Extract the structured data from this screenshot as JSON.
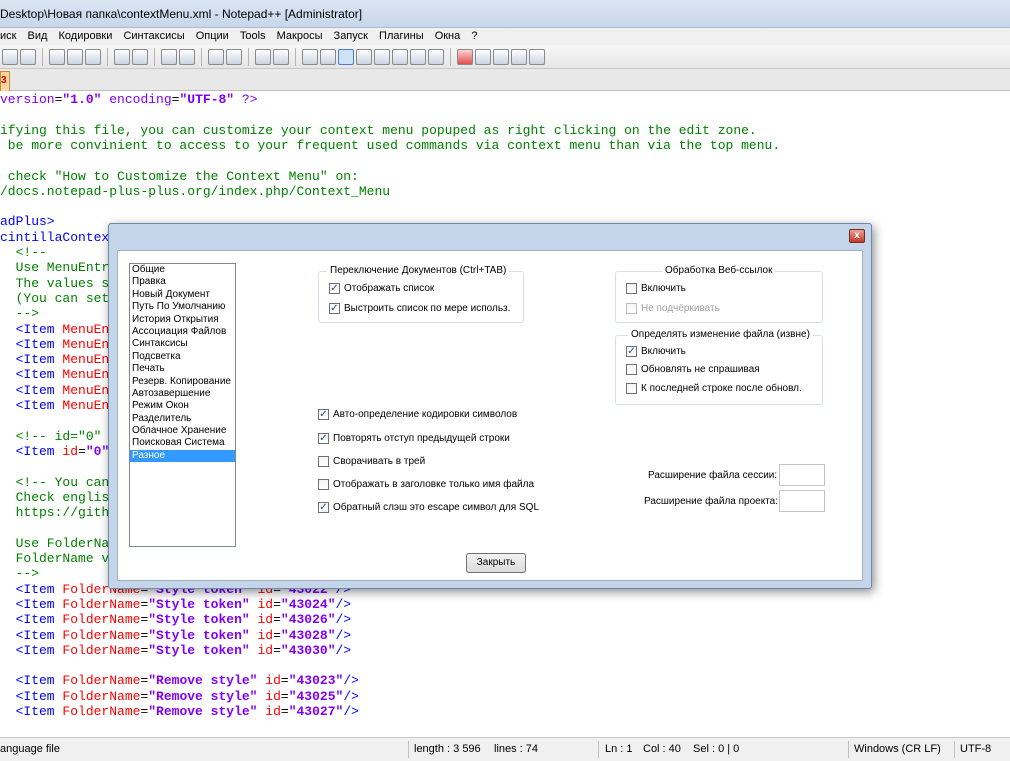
{
  "window": {
    "title": "Desktop\\Новая папка\\contextMenu.xml - Notepad++ [Administrator]"
  },
  "menu": [
    "иск",
    "Вид",
    "Кодировки",
    "Синтаксисы",
    "Опции",
    "Tools",
    "Макросы",
    "Запуск",
    "Плагины",
    "Окна",
    "?"
  ],
  "tab": {
    "label": "3"
  },
  "editor": {
    "lines": [
      {
        "y": 0,
        "segs": [
          [
            "c-decl",
            "version"
          ],
          [
            "c-text",
            "="
          ],
          [
            "c-str",
            "\"1.0\""
          ],
          [
            "c-text",
            " "
          ],
          [
            "c-decl",
            "encoding"
          ],
          [
            "c-text",
            "="
          ],
          [
            "c-str",
            "\"UTF-8\""
          ],
          [
            "c-text",
            " "
          ],
          [
            "c-decl",
            "?>"
          ]
        ]
      },
      {
        "y": 1,
        "segs": []
      },
      {
        "y": 2,
        "segs": [
          [
            "c-comment",
            "ifying this file, you can customize your context menu popuped as right clicking on the edit zone."
          ]
        ]
      },
      {
        "y": 3,
        "segs": [
          [
            "c-comment",
            " be more convinient to access to your frequent used commands via context menu than via the top menu."
          ]
        ]
      },
      {
        "y": 4,
        "segs": []
      },
      {
        "y": 5,
        "segs": [
          [
            "c-comment",
            " check \"How to Customize the Context Menu\" on:"
          ]
        ]
      },
      {
        "y": 6,
        "segs": [
          [
            "c-comment",
            "/docs.notepad-plus-plus.org/index.php/Context_Menu"
          ]
        ]
      },
      {
        "y": 7,
        "segs": []
      },
      {
        "y": 8,
        "segs": [
          [
            "c-tag",
            "adPlus>"
          ]
        ]
      },
      {
        "y": 9,
        "segs": [
          [
            "c-tag",
            "cintillaContextMenu>"
          ]
        ]
      },
      {
        "y": 10,
        "segs": [
          [
            "c-comment",
            "  <!--"
          ]
        ]
      },
      {
        "y": 11,
        "segs": [
          [
            "c-comment",
            "  Use MenuEntryName and MenuItemName to localize your commands to add."
          ]
        ]
      },
      {
        "y": 12,
        "segs": [
          [
            "c-comment",
            "  The values should be in English but not in translated language."
          ]
        ]
      },
      {
        "y": 13,
        "segs": [
          [
            "c-comment",
            "  (You can set values in translated language)"
          ]
        ]
      },
      {
        "y": 14,
        "segs": [
          [
            "c-comment",
            "  -->"
          ]
        ]
      },
      {
        "y": 15,
        "segs": [
          [
            "c-tag",
            "  <Item "
          ],
          [
            "c-attr",
            "MenuEntryName"
          ]
        ]
      },
      {
        "y": 16,
        "segs": [
          [
            "c-tag",
            "  <Item "
          ],
          [
            "c-attr",
            "MenuEntryName"
          ]
        ]
      },
      {
        "y": 17,
        "segs": [
          [
            "c-tag",
            "  <Item "
          ],
          [
            "c-attr",
            "MenuEntryName"
          ]
        ]
      },
      {
        "y": 18,
        "segs": [
          [
            "c-tag",
            "  <Item "
          ],
          [
            "c-attr",
            "MenuEntryName"
          ]
        ]
      },
      {
        "y": 19,
        "segs": [
          [
            "c-tag",
            "  <Item "
          ],
          [
            "c-attr",
            "MenuEntryName"
          ]
        ]
      },
      {
        "y": 20,
        "segs": [
          [
            "c-tag",
            "  <Item "
          ],
          [
            "c-attr",
            "MenuEntryName"
          ]
        ]
      },
      {
        "y": 21,
        "segs": []
      },
      {
        "y": 22,
        "segs": [
          [
            "c-comment",
            "  <!-- id=\"0\" is the separator -->"
          ]
        ]
      },
      {
        "y": 23,
        "segs": [
          [
            "c-tag",
            "  <Item "
          ],
          [
            "c-attr",
            "id"
          ],
          [
            "c-text",
            "="
          ],
          [
            "c-str",
            "\"0\""
          ],
          [
            "c-tag",
            "/>"
          ]
        ]
      },
      {
        "y": 24,
        "segs": []
      },
      {
        "y": 25,
        "segs": [
          [
            "c-comment",
            "  <!-- You can find all Notepad++ command id in:"
          ]
        ]
      },
      {
        "y": 26,
        "segs": [
          [
            "c-comment",
            "  Check english.xml"
          ]
        ]
      },
      {
        "y": 27,
        "segs": [
          [
            "c-comment",
            "  https://github.com/notepad-plus-plus"
          ]
        ]
      },
      {
        "y": 28,
        "segs": []
      },
      {
        "y": 29,
        "segs": [
          [
            "c-comment",
            "  Use FolderName to group commands"
          ]
        ]
      },
      {
        "y": 30,
        "segs": [
          [
            "c-comment",
            "  FolderName value can be in any language"
          ]
        ]
      },
      {
        "y": 31,
        "segs": [
          [
            "c-comment",
            "  -->"
          ]
        ]
      },
      {
        "y": 32,
        "segs": [
          [
            "c-tag",
            "  <Item "
          ],
          [
            "c-attr",
            "FolderName"
          ],
          [
            "c-text",
            "="
          ],
          [
            "c-str",
            "\"Style token\""
          ],
          [
            "c-text",
            " "
          ],
          [
            "c-attr",
            "id"
          ],
          [
            "c-text",
            "="
          ],
          [
            "c-str",
            "\"43022\""
          ],
          [
            "c-tag",
            "/>"
          ]
        ]
      },
      {
        "y": 33,
        "segs": [
          [
            "c-tag",
            "  <Item "
          ],
          [
            "c-attr",
            "FolderName"
          ],
          [
            "c-text",
            "="
          ],
          [
            "c-str",
            "\"Style token\""
          ],
          [
            "c-text",
            " "
          ],
          [
            "c-attr",
            "id"
          ],
          [
            "c-text",
            "="
          ],
          [
            "c-str",
            "\"43024\""
          ],
          [
            "c-tag",
            "/>"
          ]
        ]
      },
      {
        "y": 34,
        "segs": [
          [
            "c-tag",
            "  <Item "
          ],
          [
            "c-attr",
            "FolderName"
          ],
          [
            "c-text",
            "="
          ],
          [
            "c-str",
            "\"Style token\""
          ],
          [
            "c-text",
            " "
          ],
          [
            "c-attr",
            "id"
          ],
          [
            "c-text",
            "="
          ],
          [
            "c-str",
            "\"43026\""
          ],
          [
            "c-tag",
            "/>"
          ]
        ]
      },
      {
        "y": 35,
        "segs": [
          [
            "c-tag",
            "  <Item "
          ],
          [
            "c-attr",
            "FolderName"
          ],
          [
            "c-text",
            "="
          ],
          [
            "c-str",
            "\"Style token\""
          ],
          [
            "c-text",
            " "
          ],
          [
            "c-attr",
            "id"
          ],
          [
            "c-text",
            "="
          ],
          [
            "c-str",
            "\"43028\""
          ],
          [
            "c-tag",
            "/>"
          ]
        ]
      },
      {
        "y": 36,
        "segs": [
          [
            "c-tag",
            "  <Item "
          ],
          [
            "c-attr",
            "FolderName"
          ],
          [
            "c-text",
            "="
          ],
          [
            "c-str",
            "\"Style token\""
          ],
          [
            "c-text",
            " "
          ],
          [
            "c-attr",
            "id"
          ],
          [
            "c-text",
            "="
          ],
          [
            "c-str",
            "\"43030\""
          ],
          [
            "c-tag",
            "/>"
          ]
        ]
      },
      {
        "y": 37,
        "segs": []
      },
      {
        "y": 38,
        "segs": [
          [
            "c-tag",
            "  <Item "
          ],
          [
            "c-attr",
            "FolderName"
          ],
          [
            "c-text",
            "="
          ],
          [
            "c-str",
            "\"Remove style\""
          ],
          [
            "c-text",
            " "
          ],
          [
            "c-attr",
            "id"
          ],
          [
            "c-text",
            "="
          ],
          [
            "c-str",
            "\"43023\""
          ],
          [
            "c-tag",
            "/>"
          ]
        ]
      },
      {
        "y": 39,
        "segs": [
          [
            "c-tag",
            "  <Item "
          ],
          [
            "c-attr",
            "FolderName"
          ],
          [
            "c-text",
            "="
          ],
          [
            "c-str",
            "\"Remove style\""
          ],
          [
            "c-text",
            " "
          ],
          [
            "c-attr",
            "id"
          ],
          [
            "c-text",
            "="
          ],
          [
            "c-str",
            "\"43025\""
          ],
          [
            "c-tag",
            "/>"
          ]
        ]
      },
      {
        "y": 40,
        "segs": [
          [
            "c-tag",
            "  <Item "
          ],
          [
            "c-attr",
            "FolderName"
          ],
          [
            "c-text",
            "="
          ],
          [
            "c-str",
            "\"Remove style\""
          ],
          [
            "c-text",
            " "
          ],
          [
            "c-attr",
            "id"
          ],
          [
            "c-text",
            "="
          ],
          [
            "c-str",
            "\"43027\""
          ],
          [
            "c-tag",
            "/>"
          ]
        ]
      }
    ]
  },
  "statusbar": {
    "filetype": "anguage file",
    "length": "length : 3 596",
    "lines": "lines : 74",
    "ln": "Ln : 1",
    "col": "Col : 40",
    "sel": "Sel : 0 | 0",
    "eol": "Windows (CR LF)",
    "encoding": "UTF-8"
  },
  "dialog": {
    "close_glyph": "x",
    "categories": [
      "Общие",
      "Правка",
      "Новый Документ",
      "Путь По Умолчанию",
      "История Открытия",
      "Ассоциация Файлов",
      "Синтаксисы",
      "Подсветка",
      "Печать",
      "Резерв. Копирование",
      "Автозавершение",
      "Режим Окон",
      "Разделитель",
      "Облачное Хранение",
      "Поисковая Система",
      "Разное"
    ],
    "selected_category": 15,
    "doc_switch": {
      "title": "Переключение Документов  (Ctrl+TAB)",
      "show_list": "Отображать список",
      "order_by_use": "Выстроить список по мере использ."
    },
    "web_links": {
      "title": "Обработка  Веб-ссылок",
      "enable": "Включить",
      "no_underline": "Не подчёркивать"
    },
    "file_change": {
      "title": "Определять изменение файла  (извне)",
      "enable": "Включить",
      "update_silently": "Обновлять не спрашивая",
      "scroll_to_last": "К последней строке после обновл."
    },
    "misc": {
      "auto_detect_encoding": "Авто-определение кодировки символов",
      "maintain_indent": "Повторять отступ предыдущей строки",
      "minimize_to_tray": "Сворачивать в трей",
      "show_only_filename": "Отображать в заголовке только имя файла",
      "backslash_escape": "Обратный слэш это escape символ для SQL"
    },
    "session_ext_label": "Расширение файла сессии:",
    "project_ext_label": "Расширение файла проекта:",
    "session_ext_value": "",
    "project_ext_value": "",
    "close_button": "Закрыть"
  }
}
